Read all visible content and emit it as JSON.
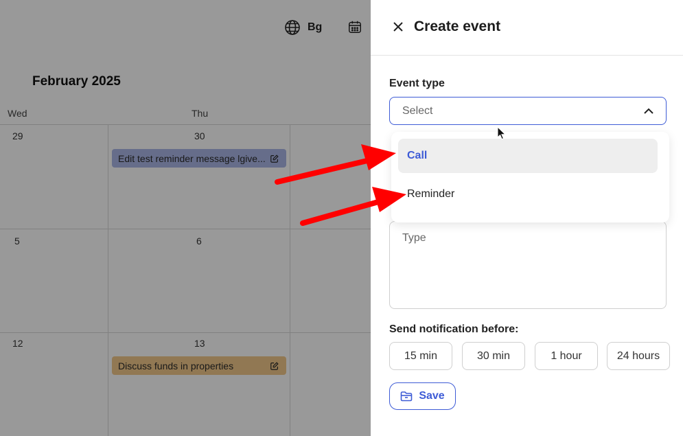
{
  "calendar": {
    "lang_label": "Bg",
    "month_title": "February 2025",
    "weekdays": [
      "Wed",
      "Thu"
    ],
    "dates": [
      "29",
      "30",
      "5",
      "6",
      "12",
      "13"
    ],
    "events": [
      {
        "title": "Edit test reminder message lgive...",
        "color": "#aab6e6"
      },
      {
        "title": "Discuss funds in properties",
        "color": "#f2c98a"
      }
    ]
  },
  "panel": {
    "title": "Create event",
    "event_type_label": "Event type",
    "select_placeholder": "Select",
    "options": [
      "Call",
      "Reminder"
    ],
    "type_placeholder": "Type",
    "notification_label": "Send notification before:",
    "notification_options": [
      "15 min",
      "30 min",
      "1 hour",
      "24 hours"
    ],
    "save_label": "Save"
  },
  "colors": {
    "accent": "#3d5bd6",
    "arrow": "#ff0000"
  }
}
